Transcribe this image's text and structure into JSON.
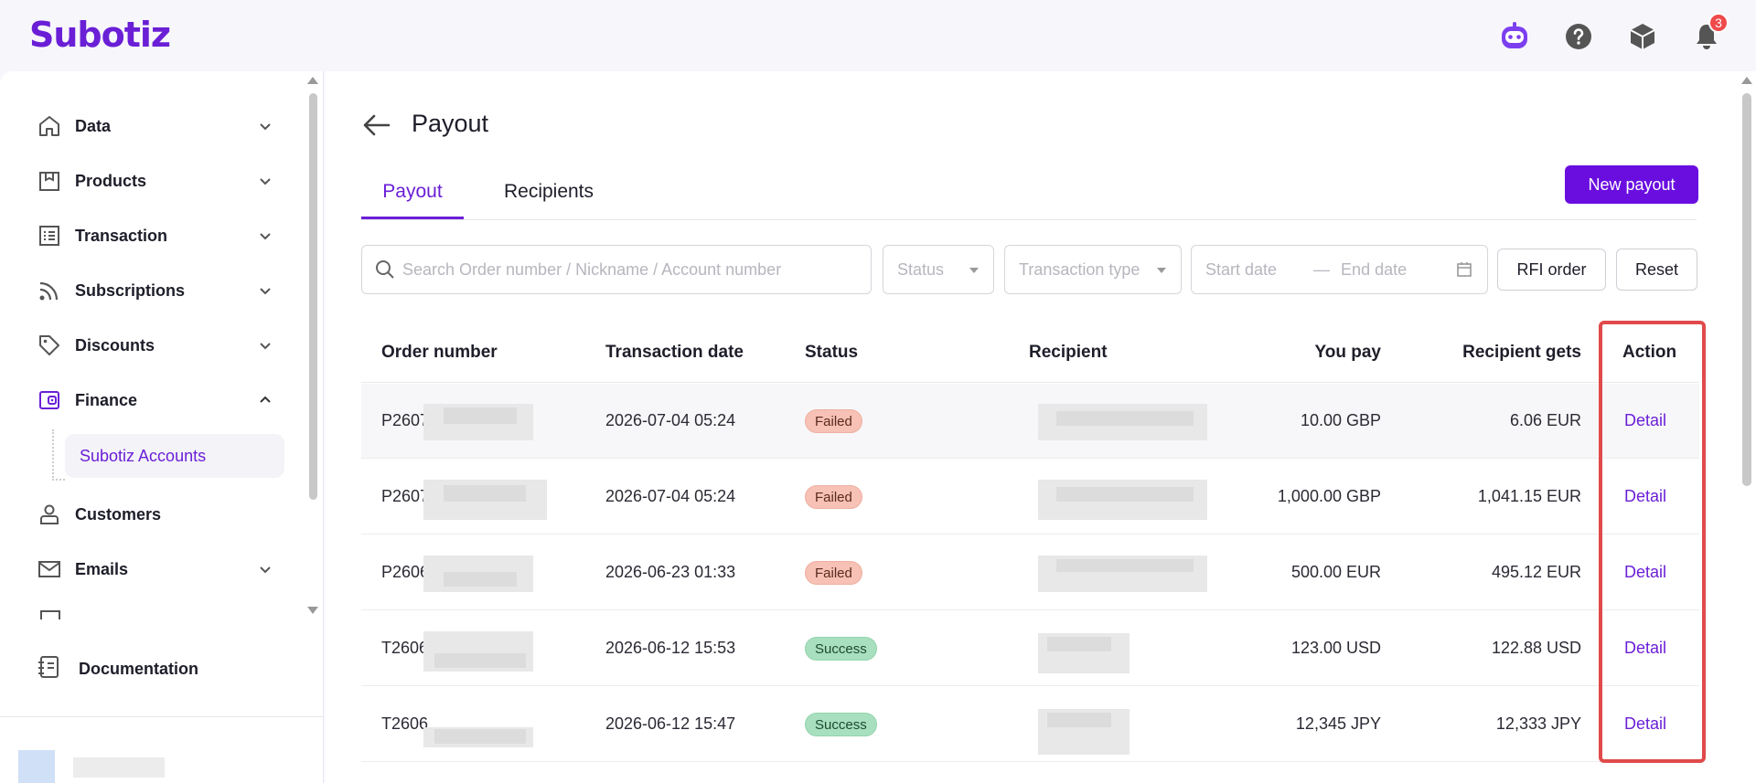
{
  "app": {
    "name": "Subotiz"
  },
  "colors": {
    "brand": "#6a1fd6",
    "primary_button": "#6a0ee0",
    "failed_bg": "#f7c1b5",
    "success_bg": "#a8dfbf",
    "highlight": "#e04a4a"
  },
  "header": {
    "icons": [
      "ai-assistant-icon",
      "help-icon",
      "package-icon",
      "bell-icon"
    ],
    "notification_count": "3"
  },
  "sidebar": {
    "items": [
      {
        "label": "Data",
        "icon": "home-icon",
        "expanded": false
      },
      {
        "label": "Products",
        "icon": "box-icon",
        "expanded": false
      },
      {
        "label": "Transaction",
        "icon": "list-icon",
        "expanded": false
      },
      {
        "label": "Subscriptions",
        "icon": "rss-icon",
        "expanded": false
      },
      {
        "label": "Discounts",
        "icon": "tag-icon",
        "expanded": false
      },
      {
        "label": "Finance",
        "icon": "wallet-icon",
        "expanded": true
      },
      {
        "label": "Customers",
        "icon": "user-icon",
        "expanded": false
      },
      {
        "label": "Emails",
        "icon": "mail-icon",
        "expanded": false
      }
    ],
    "sub_item": "Subotiz Accounts",
    "documentation": "Documentation"
  },
  "main": {
    "title": "Payout",
    "tabs": [
      {
        "label": "Payout",
        "active": true
      },
      {
        "label": "Recipients",
        "active": false
      }
    ],
    "new_payout": "New payout",
    "filters": {
      "search_placeholder": "Search Order number / Nickname / Account number",
      "status_placeholder": "Status",
      "type_placeholder": "Transaction type",
      "start_date": "Start date",
      "date_sep": "—",
      "end_date": "End date",
      "rfi_order": "RFI order",
      "reset": "Reset"
    },
    "table": {
      "columns": [
        "Order number",
        "Transaction date",
        "Status",
        "Recipient",
        "You pay",
        "Recipient gets",
        "Action"
      ],
      "rows": [
        {
          "order": "P2607",
          "date": "2026-07-04 05:24",
          "status": "Failed",
          "you_pay": "10.00 GBP",
          "gets": "6.06 EUR",
          "action": "Detail"
        },
        {
          "order": "P2607",
          "date": "2026-07-04 05:24",
          "status": "Failed",
          "you_pay": "1,000.00 GBP",
          "gets": "1,041.15 EUR",
          "action": "Detail"
        },
        {
          "order": "P2606",
          "date": "2026-06-23 01:33",
          "status": "Failed",
          "you_pay": "500.00 EUR",
          "gets": "495.12 EUR",
          "action": "Detail"
        },
        {
          "order": "T2606",
          "date": "2026-06-12 15:53",
          "status": "Success",
          "you_pay": "123.00 USD",
          "gets": "122.88 USD",
          "action": "Detail"
        },
        {
          "order": "T2606",
          "date": "2026-06-12 15:47",
          "status": "Success",
          "you_pay": "12,345 JPY",
          "gets": "12,333 JPY",
          "action": "Detail"
        }
      ]
    }
  }
}
